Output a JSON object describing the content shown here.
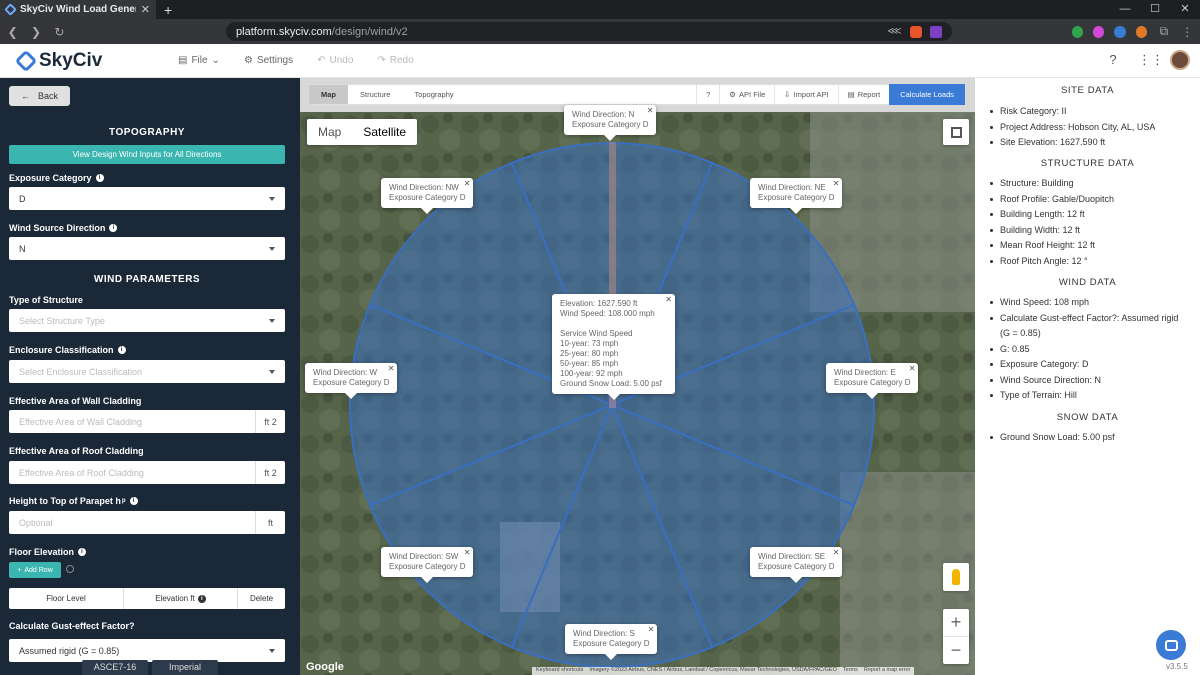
{
  "browser": {
    "tab_title": "SkyCiv Wind Load Generat",
    "url_host": "platform.skyciv.com",
    "url_path": "/design/wind/v2"
  },
  "app": {
    "logo_text": "SkyCiv",
    "menu": {
      "file": "File",
      "settings": "Settings",
      "undo": "Undo",
      "redo": "Redo"
    }
  },
  "left": {
    "back": "Back",
    "topography_title": "TOPOGRAPHY",
    "view_inputs_btn": "View Design Wind Inputs for All Directions",
    "exposure_label": "Exposure Category",
    "exposure_value": "D",
    "wind_source_label": "Wind Source Direction",
    "wind_source_value": "N",
    "wind_params_title": "WIND PARAMETERS",
    "structure_type_label": "Type of Structure",
    "structure_type_placeholder": "Select Structure Type",
    "enclosure_label": "Enclosure Classification",
    "enclosure_placeholder": "Select Enclosure Classification",
    "wall_cladding_label": "Effective Area of Wall Cladding",
    "wall_cladding_placeholder": "Effective Area of Wall Cladding",
    "roof_cladding_label": "Effective Area of Roof Cladding",
    "roof_cladding_placeholder": "Effective Area of Roof Cladding",
    "area_unit": "ft 2",
    "parapet_label": "Height to Top of Parapet h",
    "parapet_sub": "p",
    "parapet_placeholder": "Optional",
    "length_unit": "ft",
    "floor_elev_label": "Floor Elevation",
    "add_row": "Add Row",
    "col_floor_level": "Floor Level",
    "col_elevation": "Elevation ft",
    "col_delete": "Delete",
    "gust_label": "Calculate Gust-effect Factor?",
    "gust_value": "Assumed rigid (G = 0.85)",
    "footer_code": "ASCE7-16",
    "footer_units": "Imperial"
  },
  "toolbar": {
    "tab_map": "Map",
    "tab_structure": "Structure",
    "tab_topography": "Topography",
    "help": "?",
    "api_file": "API File",
    "import_api": "Import API",
    "report": "Report",
    "calculate": "Calculate Loads"
  },
  "map": {
    "type_map": "Map",
    "type_satellite": "Satellite",
    "google": "Google",
    "attribution": [
      "Keyboard shortcuts",
      "Imagery ©2023 Airbus, CNES / Airbus, Landsat / Copernicus, Maxar Technologies, USDA/FPAC/GEO",
      "Terms",
      "Report a map error"
    ],
    "bubbles": {
      "n": [
        "Wind Direction: N",
        "Exposure Category D"
      ],
      "nw": [
        "Wind Direction: NW",
        "Exposure Category D"
      ],
      "ne": [
        "Wind Direction: NE",
        "Exposure Category D"
      ],
      "w": [
        "Wind Direction: W",
        "Exposure Category D"
      ],
      "e": [
        "Wind Direction: E",
        "Exposure Category D"
      ],
      "sw": [
        "Wind Direction: SW",
        "Exposure Category D"
      ],
      "se": [
        "Wind Direction: SE",
        "Exposure Category D"
      ],
      "s": [
        "Wind Direction: S",
        "Exposure Category D"
      ],
      "center": [
        "Elevation: 1627.590 ft",
        "Wind Speed: 108.000 mph",
        "",
        "Service Wind Speed",
        "10-year: 73 mph",
        "25-year: 80 mph",
        "50-year: 85 mph",
        "100-year: 92 mph",
        "Ground Snow Load: 5.00 psf"
      ]
    },
    "sector_fill": "#3a6fc0"
  },
  "right": {
    "site_title": "SITE DATA",
    "site": [
      "Risk Category: II",
      "Project Address: Hobson City, AL, USA",
      "Site Elevation: 1627.590 ft"
    ],
    "structure_title": "STRUCTURE DATA",
    "structure": [
      "Structure: Building",
      "Roof Profile: Gable/Duopitch",
      "Building Length: 12 ft",
      "Building Width: 12 ft",
      "Mean Roof Height: 12 ft",
      "Roof Pitch Angle: 12 °"
    ],
    "wind_title": "WIND DATA",
    "wind": [
      "Wind Speed: 108 mph",
      "Calculate Gust-effect Factor?: Assumed rigid (G = 0.85)",
      "G: 0.85",
      "Exposure Category: D",
      "Wind Source Direction: N",
      "Type of Terrain: Hill"
    ],
    "snow_title": "SNOW DATA",
    "snow": [
      "Ground Snow Load: 5.00 psf"
    ],
    "version": "v3.5.5"
  }
}
